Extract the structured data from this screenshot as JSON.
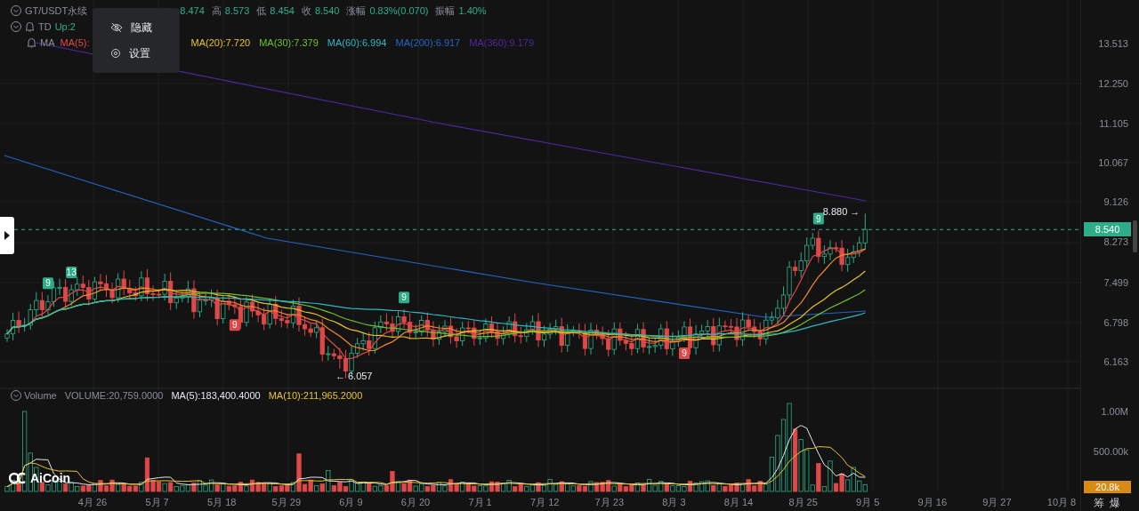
{
  "legend": {
    "symbol": "GT/USDT永续",
    "quote": [
      {
        "value": "8.474"
      },
      {
        "label": "高",
        "value": "8.573"
      },
      {
        "label": "低",
        "value": "8.454"
      },
      {
        "label": "收",
        "value": "8.540"
      },
      {
        "label": "涨幅",
        "value": "0.83%(0.070)"
      },
      {
        "label": "振幅",
        "value": "1.40%"
      }
    ]
  },
  "td": {
    "label": "TD",
    "value": "Up:2"
  },
  "ma": {
    "label": "MA",
    "items": [
      {
        "text": "MA(5):",
        "color": "#e04848"
      },
      {
        "text": "MA(20):7.720",
        "color": "#e8c326"
      },
      {
        "text": "MA(30):7.379",
        "color": "#6ec02f"
      },
      {
        "text": "MA(60):6.994",
        "color": "#2bb8c4"
      },
      {
        "text": "MA(200):6.917",
        "color": "#2266c4"
      },
      {
        "text": "MA(360):9.179",
        "color": "#4b2aa0"
      }
    ]
  },
  "menu": [
    {
      "label": "隐藏"
    },
    {
      "label": "设置"
    }
  ],
  "price_axis": [
    "13.513",
    "12.250",
    "11.105",
    "10.067",
    "9.126",
    "8.273",
    "7.499",
    "6.798",
    "6.163"
  ],
  "last_price": "8.540",
  "markers": [
    {
      "text": "9",
      "kind": "up"
    },
    {
      "text": "13",
      "kind": "up"
    },
    {
      "text": "9",
      "kind": "down"
    },
    {
      "text": "9",
      "kind": "up"
    },
    {
      "text": "9",
      "kind": "down"
    },
    {
      "text": "9",
      "kind": "up"
    }
  ],
  "high_label": "8.880 →",
  "low_label": "← 6.057",
  "volume_legend": {
    "title": "Volume",
    "items": [
      {
        "text": "VOLUME:20,759.0000",
        "color": "#8a8f98"
      },
      {
        "text": "MA(5):183,400.4000",
        "color": "#e6e8ee"
      },
      {
        "text": "MA(10):211,965.2000",
        "color": "#e8c326"
      }
    ]
  },
  "volume_axis": [
    "1.00M",
    "500.00k"
  ],
  "last_volume": "20.8k",
  "logo": "AiCoin",
  "x_axis": [
    "4月 26",
    "5月 7",
    "5月 18",
    "5月 29",
    "6月 9",
    "6月 20",
    "7月 1",
    "7月 12",
    "7月 23",
    "8月 3",
    "8月 14",
    "8月 25",
    "9月 5",
    "9月 16",
    "9月 27",
    "10月 8"
  ],
  "side_buttons": [
    "筹",
    "爆"
  ]
}
